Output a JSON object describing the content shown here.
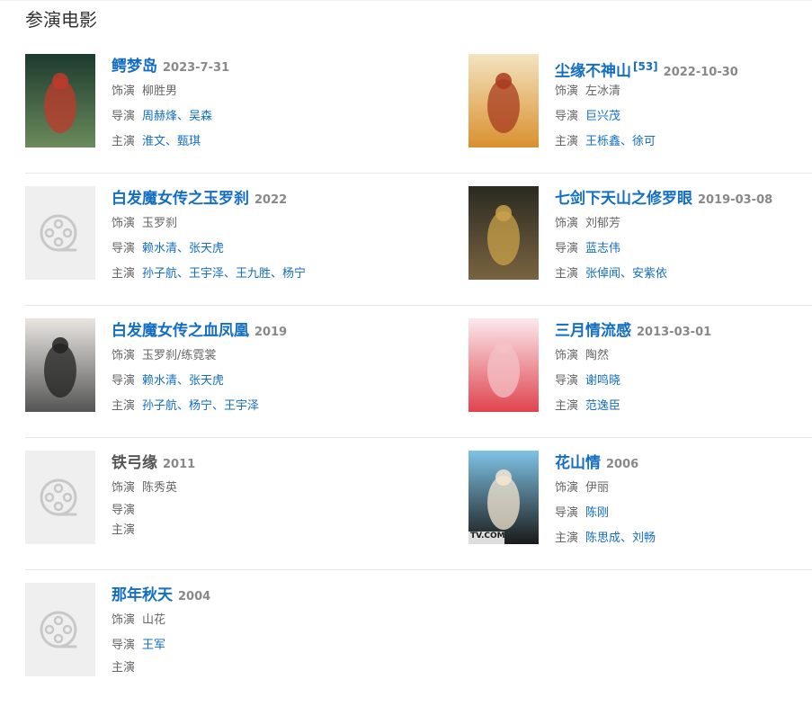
{
  "section_title": "参演电影",
  "labels": {
    "role": "饰演",
    "director": "导演",
    "cast": "主演"
  },
  "films": [
    {
      "title": "鳄梦岛",
      "year": "2023-7-31",
      "role": "柳胜男",
      "director": "周赫烽、吴森",
      "cast": "淮文、甄琪",
      "poster": "image",
      "poster_colors": [
        "#1c3b2e",
        "#6b8a5c",
        "#c0392b"
      ]
    },
    {
      "title": "尘缘不神山",
      "sup": "[53]",
      "year": "2022-10-30",
      "role": "左冰清",
      "director": "巨兴茂",
      "cast": "王栎鑫、徐可",
      "poster": "image",
      "poster_colors": [
        "#f4e3c1",
        "#d9902e",
        "#a83b20"
      ]
    },
    {
      "title": "白发魔女传之玉罗刹",
      "year": "2022",
      "role": "玉罗刹",
      "director": "赖水清、张天虎",
      "cast": "孙子航、王宇泽、王九胜、杨宁",
      "poster": "placeholder"
    },
    {
      "title": "七剑下天山之修罗眼",
      "year": "2019-03-08",
      "role": "刘郁芳",
      "director": "蓝志伟",
      "cast": "张倬闻、安紫依",
      "poster": "image",
      "poster_colors": [
        "#2a2a22",
        "#7a6440",
        "#c9a24a"
      ]
    },
    {
      "title": "白发魔女传之血凤凰",
      "year": "2019",
      "role": "玉罗刹/练霓裳",
      "director": "赖水清、张天虎",
      "cast": "孙子航、杨宁、王宇泽",
      "poster": "image",
      "poster_colors": [
        "#e9e6e2",
        "#555",
        "#222"
      ]
    },
    {
      "title": "三月情流感",
      "year": "2013-03-01",
      "role": "陶然",
      "director": "谢鸣晓",
      "cast": "范逸臣",
      "poster": "image",
      "poster_colors": [
        "#fbe9ec",
        "#e0444f",
        "#f3c2c6"
      ]
    },
    {
      "title": "铁弓缘",
      "year": "2011",
      "role": "陈秀英",
      "director": "",
      "cast": "",
      "poster": "placeholder",
      "plain": true
    },
    {
      "title": "花山情",
      "year": "2006",
      "role": "伊丽",
      "director": "陈刚",
      "cast": "陈思成、刘畅",
      "poster": "image",
      "poster_colors": [
        "#7fc3e6",
        "#1a1a1a",
        "#f3e6d0"
      ],
      "poster_text": "TV.COM"
    },
    {
      "title": "那年秋天",
      "year": "2004",
      "role": "山花",
      "director": "王军",
      "cast": "",
      "poster": "placeholder"
    }
  ]
}
